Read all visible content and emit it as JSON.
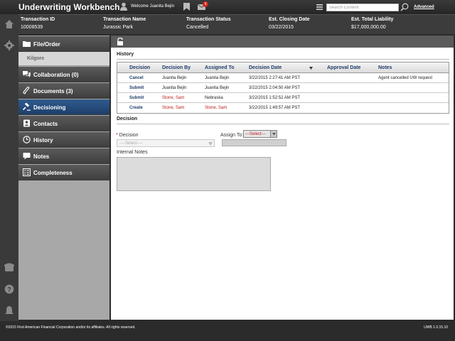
{
  "header": {
    "app_title": "Underwriting Workbench",
    "welcome_text": "Welcome Juanita Bejin",
    "mail_badge_count": "9",
    "search_placeholder": "Search Content",
    "advanced_label": "Advanced"
  },
  "transaction": {
    "columns": [
      {
        "label": "Transaction ID",
        "value": "10008539"
      },
      {
        "label": "Transaction Name",
        "value": "Jurassic Park"
      },
      {
        "label": "Transaction Status",
        "value": "Cancelled"
      },
      {
        "label": "Est. Closing Date",
        "value": "03/22/2015"
      },
      {
        "label": "Est. Total Liability",
        "value": "$17,000,000.00"
      }
    ]
  },
  "sidebar": {
    "items": [
      {
        "label": "File/Order",
        "icon": "folder-icon"
      },
      {
        "label": "Collaboration (0)",
        "icon": "collaboration-icon"
      },
      {
        "label": "Documents (3)",
        "icon": "paperclip-icon"
      },
      {
        "label": "Decisioning",
        "icon": "gavel-icon",
        "active": true
      },
      {
        "label": "Contacts",
        "icon": "contacts-icon"
      },
      {
        "label": "History",
        "icon": "clock-icon"
      },
      {
        "label": "Notes",
        "icon": "notes-icon"
      },
      {
        "label": "Completeness",
        "icon": "checklist-icon"
      }
    ],
    "sub_item": "Kilgore"
  },
  "rail": {
    "icons": [
      "home-icon",
      "settings-icon",
      "phone-icon",
      "help-icon",
      "bell-icon"
    ]
  },
  "history": {
    "title": "History",
    "headers": {
      "decision": "Decision",
      "decision_by": "Decision By",
      "assigned_to": "Assigned To",
      "decision_date": "Decision Date",
      "approval_date": "Approval Date",
      "notes": "Notes"
    },
    "rows": [
      {
        "decision": "Cancel",
        "decision_by": "Juanita Bejin",
        "assigned_to": "Juanita Bejin",
        "decision_date": "3/22/2015 2:27:41 AM PST",
        "approval_date": "",
        "notes": "Agent cancelled UW request"
      },
      {
        "decision": "Submit",
        "decision_by": "Juanita Bejin",
        "assigned_to": "Juanita Bejin",
        "decision_date": "3/22/2015 2:04:50 AM PST",
        "approval_date": "",
        "notes": ""
      },
      {
        "decision": "Submit",
        "decision_by": "Stone, Sam",
        "assigned_to": "Nebraska",
        "decision_date": "3/22/2015 1:52:52 AM PST",
        "approval_date": "",
        "notes": ""
      },
      {
        "decision": "Create",
        "decision_by": "Stone, Sam",
        "assigned_to": "Stone, Sam",
        "decision_date": "3/22/2015 1:49:57 AM PST",
        "approval_date": "",
        "notes": ""
      }
    ]
  },
  "decision_form": {
    "title": "Decision",
    "required_mark": "*",
    "decision_label": "Decision",
    "decision_select_value": "----Select----",
    "assign_to_label": "Assign To:",
    "assign_select_value": "---Select---",
    "internal_notes_label": "Internal Notes"
  },
  "footer": {
    "copyright": "©2015 First American Financial Corporation and/or its affiliates. All rights reserved.",
    "version": "UWB 1.0.15.10"
  },
  "colors": {
    "active_nav": "#1e3f6a",
    "link_blue": "#1d3c6a",
    "alert_red": "#b9211a",
    "badge_red": "#d0261b"
  }
}
